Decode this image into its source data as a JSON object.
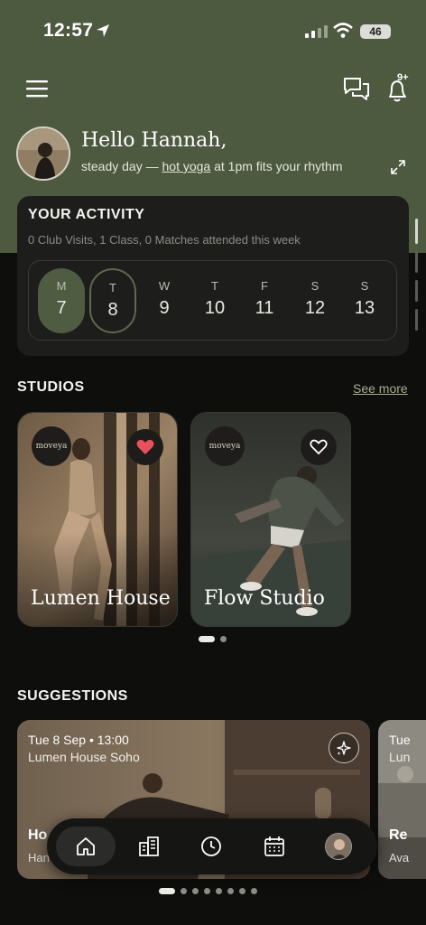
{
  "status_bar": {
    "time": "12:57",
    "battery": "46"
  },
  "header": {
    "notifications_badge": "9+"
  },
  "greeting": {
    "title": "Hello Hannah,",
    "subline_prefix": "steady day —",
    "subline_link": "hot yoga",
    "subline_suffix": "at 1pm fits your rhythm"
  },
  "activity": {
    "title": "YOUR ACTIVITY",
    "stats": "0 Club Visits, 1 Class, 0 Matches attended this week",
    "days": [
      {
        "letter": "M",
        "num": "7",
        "state": "selected"
      },
      {
        "letter": "T",
        "num": "8",
        "state": "today"
      },
      {
        "letter": "W",
        "num": "9",
        "state": ""
      },
      {
        "letter": "T",
        "num": "10",
        "state": ""
      },
      {
        "letter": "F",
        "num": "11",
        "state": ""
      },
      {
        "letter": "S",
        "num": "12",
        "state": ""
      },
      {
        "letter": "S",
        "num": "13",
        "state": ""
      }
    ]
  },
  "studios": {
    "title": "STUDIOS",
    "see_more": "See more",
    "items": [
      {
        "name": "Lumen House",
        "logo": "moveya",
        "favorited": true
      },
      {
        "name": "Flow Studio",
        "logo": "moveya",
        "favorited": false
      }
    ]
  },
  "suggestions": {
    "title": "SUGGESTIONS",
    "items": [
      {
        "date": "Tue 8 Sep • 13:00",
        "location": "Lumen House Soho",
        "title": "Ho",
        "sub": "Han"
      },
      {
        "date": "Tue",
        "location": "Lun",
        "title": "Re",
        "sub": "Ava"
      }
    ]
  },
  "tabbar": {
    "items": [
      "home-icon",
      "studios-building-icon",
      "history-clock-icon",
      "calendar-icon",
      "profile-avatar"
    ]
  },
  "colors": {
    "accent_olive": "#4d5a3f",
    "favorite_red": "#e8505b",
    "background": "#0e0e0d"
  }
}
